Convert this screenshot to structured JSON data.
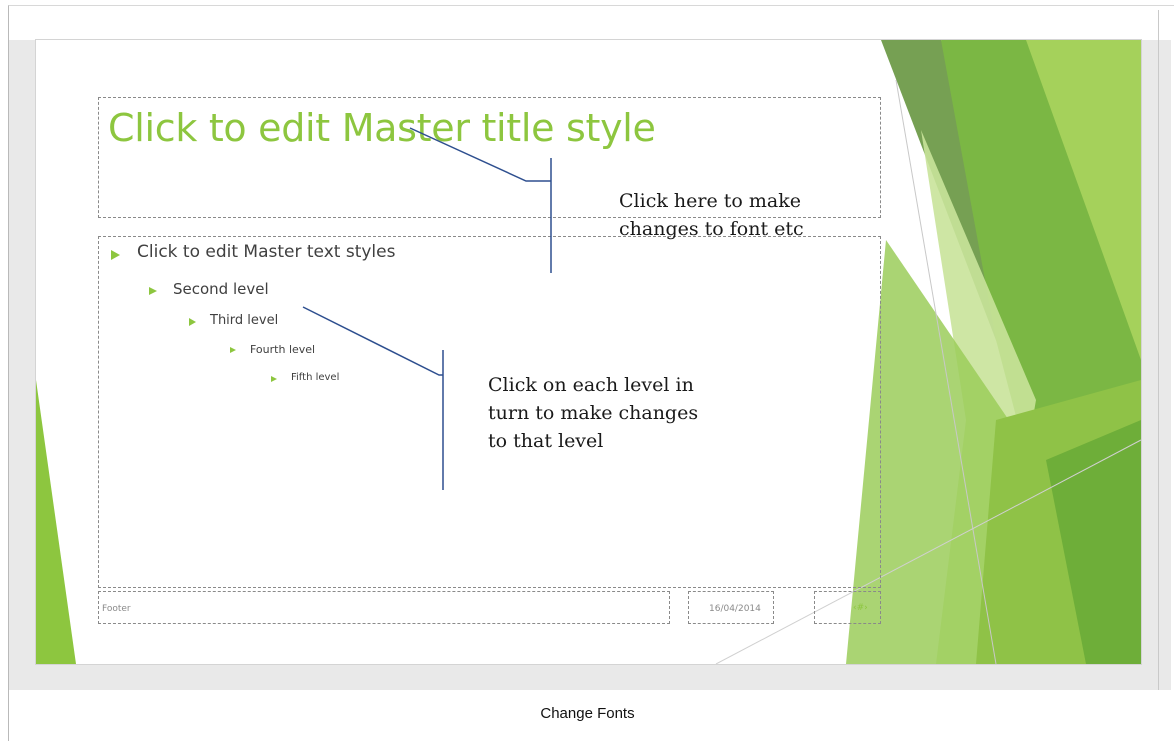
{
  "slide": {
    "title": "Click to edit Master title style",
    "levels": [
      {
        "label": "Click to edit Master text styles"
      },
      {
        "label": "Second level"
      },
      {
        "label": "Third level"
      },
      {
        "label": "Fourth level"
      },
      {
        "label": "Fifth level"
      }
    ],
    "footer": "Footer",
    "date": "16/04/2014",
    "slide_number": "‹#›"
  },
  "annotations": {
    "title_note_line1": "Click here to make",
    "title_note_line2": "changes to font etc",
    "level_note_line1": "Click on each level in",
    "level_note_line2": "turn to make changes",
    "level_note_line3": "to that level"
  },
  "caption": "Change Fonts",
  "colors": {
    "accent_green": "#8dc63f",
    "dark_green": "#4e8f2a",
    "callout_line": "#2e4f8f"
  }
}
